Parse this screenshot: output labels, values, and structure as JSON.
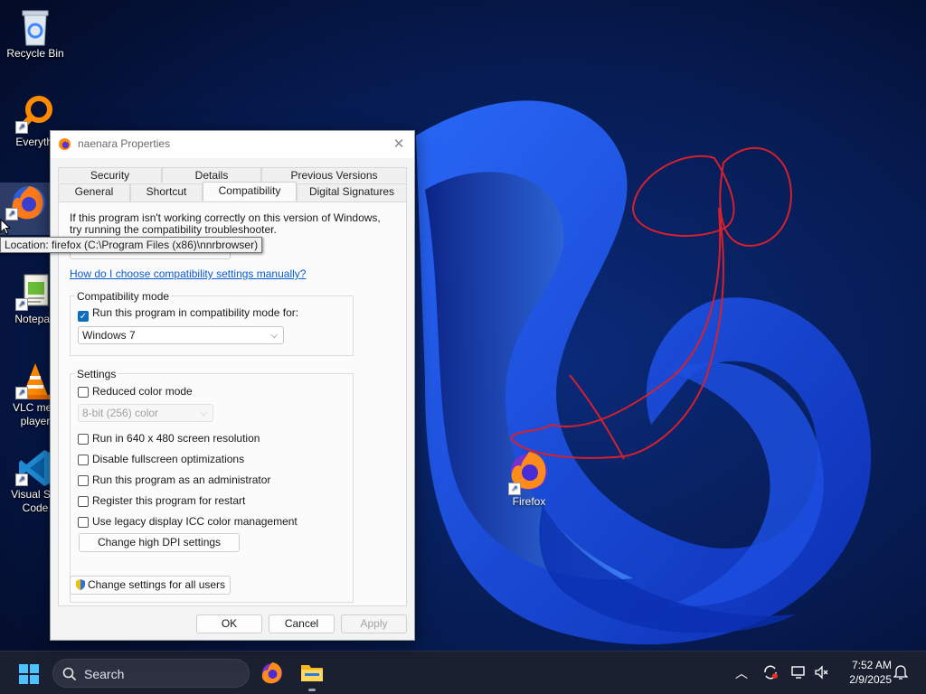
{
  "desktop": {
    "icons": [
      {
        "label": "Recycle Bin"
      },
      {
        "label": "Everythi"
      },
      {
        "label": ""
      },
      {
        "label": "Notepad"
      },
      {
        "label": "VLC med\nplayer"
      },
      {
        "label": "Visual Stu\nCode"
      }
    ],
    "firefox_icon": {
      "label": "Firefox"
    },
    "tooltip": "Location: firefox (C:\\Program Files (x86)\\nnrbrowser)"
  },
  "dialog": {
    "title": "naenara Properties",
    "tabs_row1": [
      "Security",
      "Details",
      "Previous Versions"
    ],
    "tabs_row2": [
      "General",
      "Shortcut",
      "Compatibility",
      "Digital Signatures"
    ],
    "active_tab": "Compatibility",
    "intro_line1": "If this program isn't working correctly on this version of Windows,",
    "intro_line2": "try running the compatibility troubleshooter.",
    "help_link": "How do I choose compatibility settings manually?",
    "compat_mode": {
      "group_label": "Compatibility mode",
      "checkbox_label": "Run this program in compatibility mode for:",
      "checked": true,
      "selected_os": "Windows 7"
    },
    "settings": {
      "group_label": "Settings",
      "reduced_color": "Reduced color mode",
      "color_select": "8-bit (256) color",
      "res_640": "Run in 640 x 480 screen resolution",
      "disable_fullscreen": "Disable fullscreen optimizations",
      "run_admin": "Run this program as an administrator",
      "register_restart": "Register this program for restart",
      "legacy_icc": "Use legacy display ICC color management",
      "high_dpi_button": "Change high DPI settings"
    },
    "all_users_button": "Change settings for all users",
    "ok": "OK",
    "cancel": "Cancel",
    "apply": "Apply"
  },
  "taskbar": {
    "search_placeholder": "Search",
    "time": "7:52 AM",
    "date": "2/9/2025"
  },
  "colors": {
    "accent": "#0f6cbd",
    "link": "#0a5bd6",
    "annotation": "#d8202c"
  }
}
